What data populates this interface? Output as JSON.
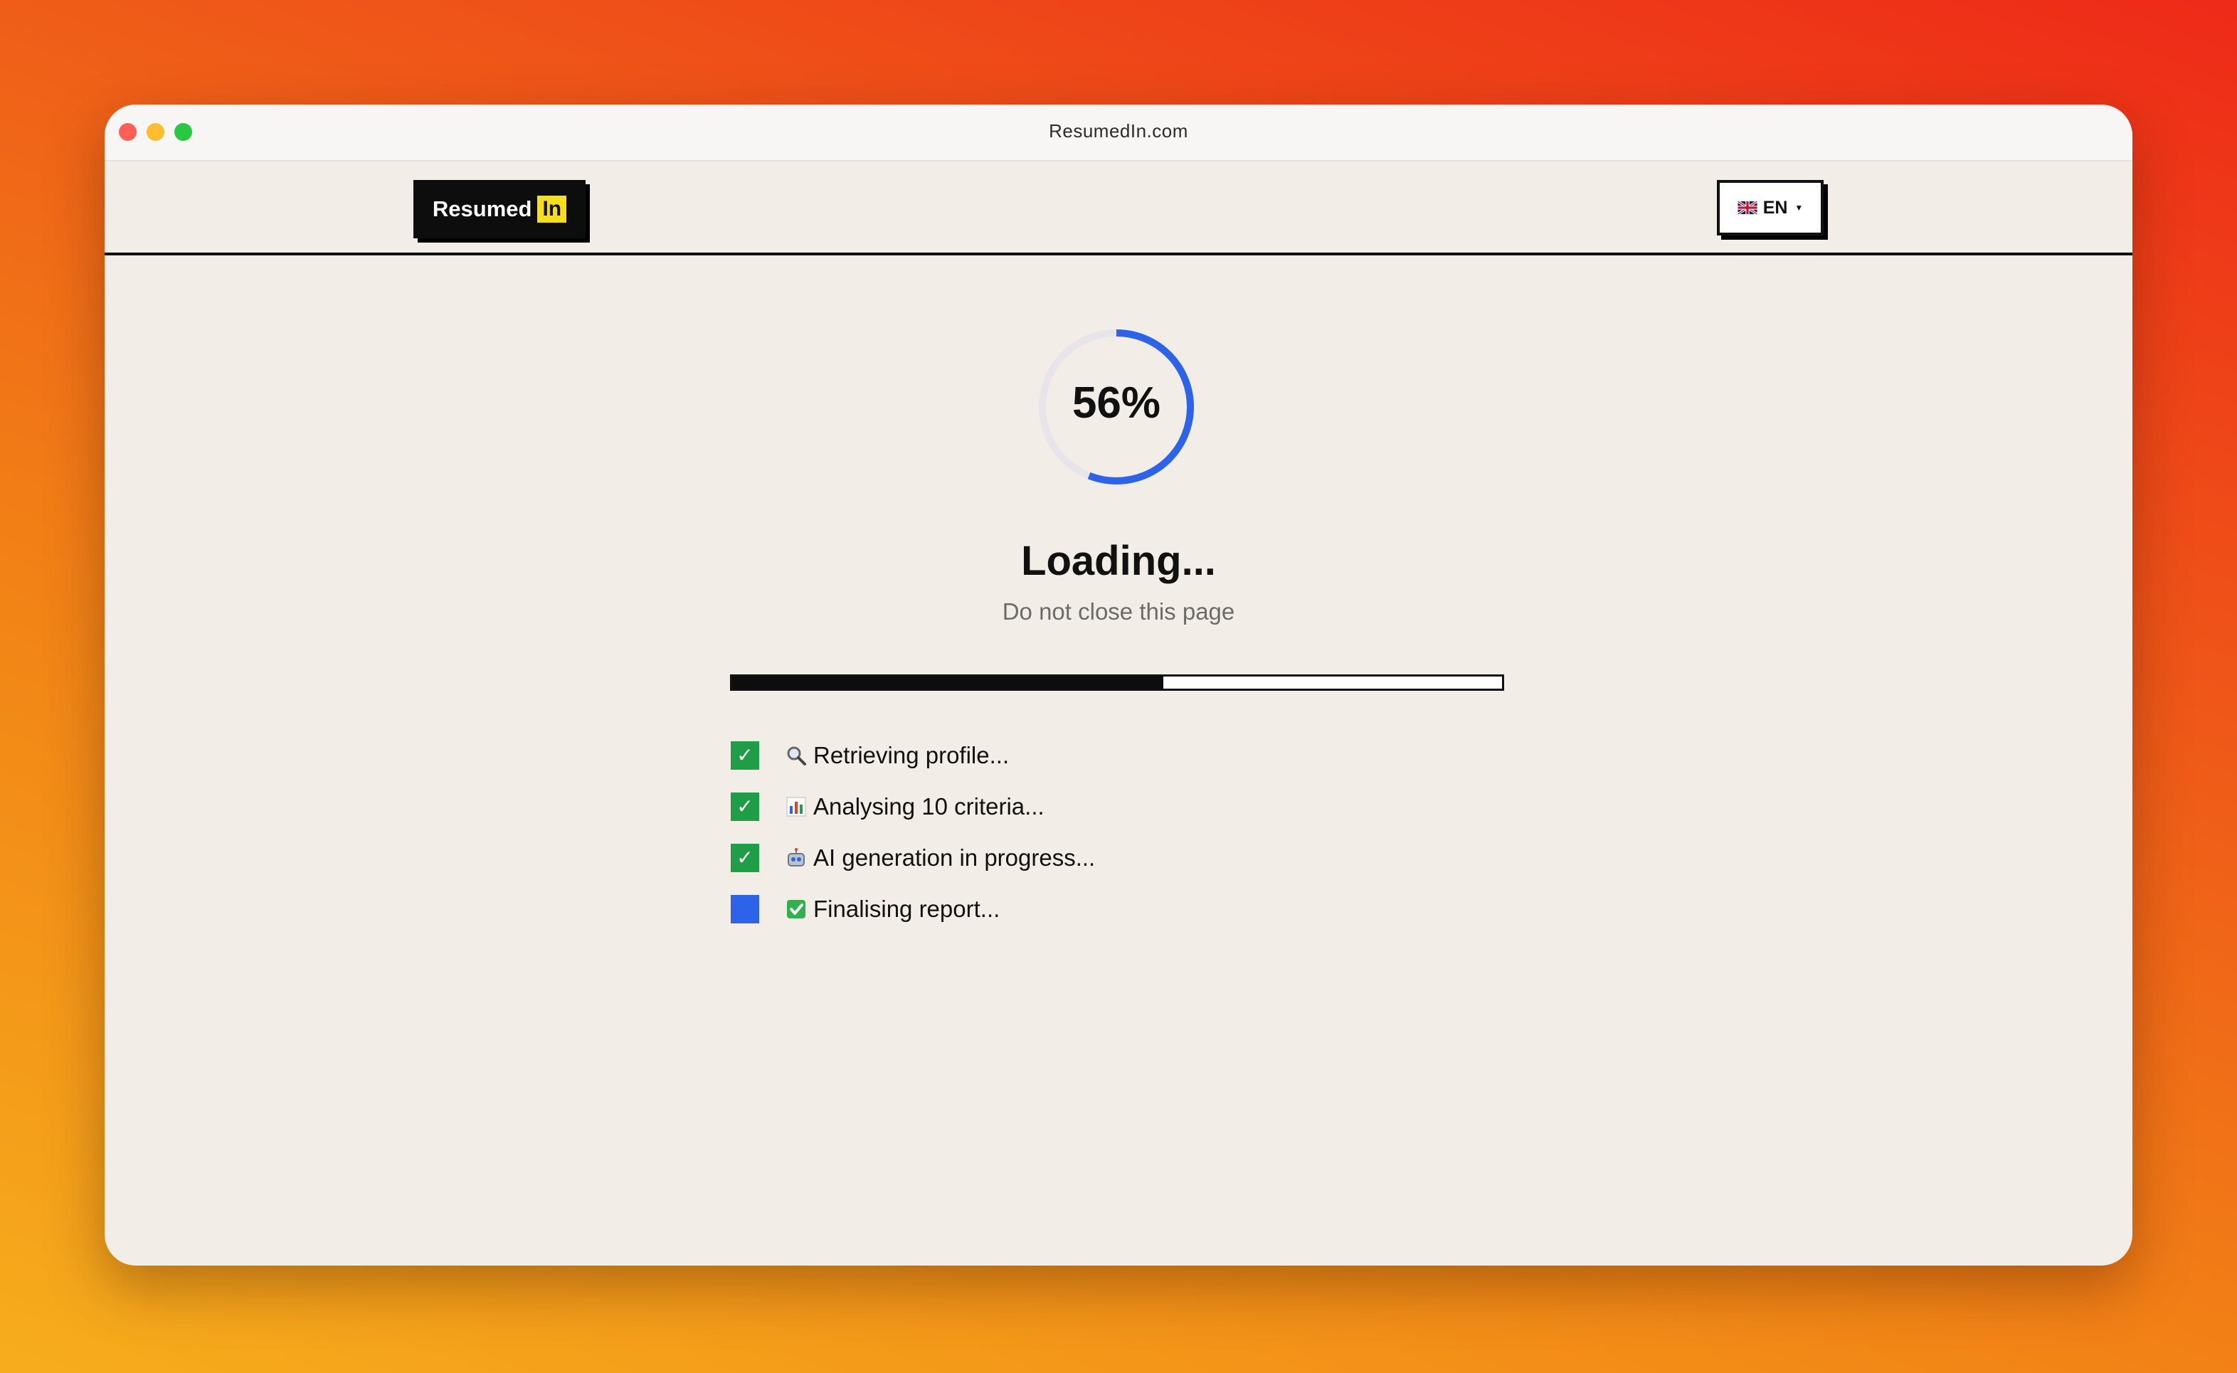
{
  "browser": {
    "url": "ResumedIn.com"
  },
  "header": {
    "logo_text": "Resumed",
    "logo_badge": "In",
    "language": {
      "code": "EN",
      "flag_icon": "uk-flag-icon"
    }
  },
  "loader": {
    "percent": 56,
    "percent_label": "56%",
    "title": "Loading...",
    "subtitle": "Do not close this page",
    "progress_fraction": 0.56
  },
  "steps": [
    {
      "icon": "magnifier-icon",
      "label": "Retrieving profile...",
      "status": "done"
    },
    {
      "icon": "bar-chart-icon",
      "label": "Analysing 10 criteria...",
      "status": "done"
    },
    {
      "icon": "robot-icon",
      "label": "AI generation in progress...",
      "status": "done"
    },
    {
      "icon": "green-check-icon",
      "label": "Finalising report...",
      "status": "in-progress"
    }
  ],
  "colors": {
    "accent_blue": "#2c63e8",
    "done_green": "#1f9e47",
    "logo_yellow": "#f6de1b",
    "background": "#f2eee7"
  }
}
